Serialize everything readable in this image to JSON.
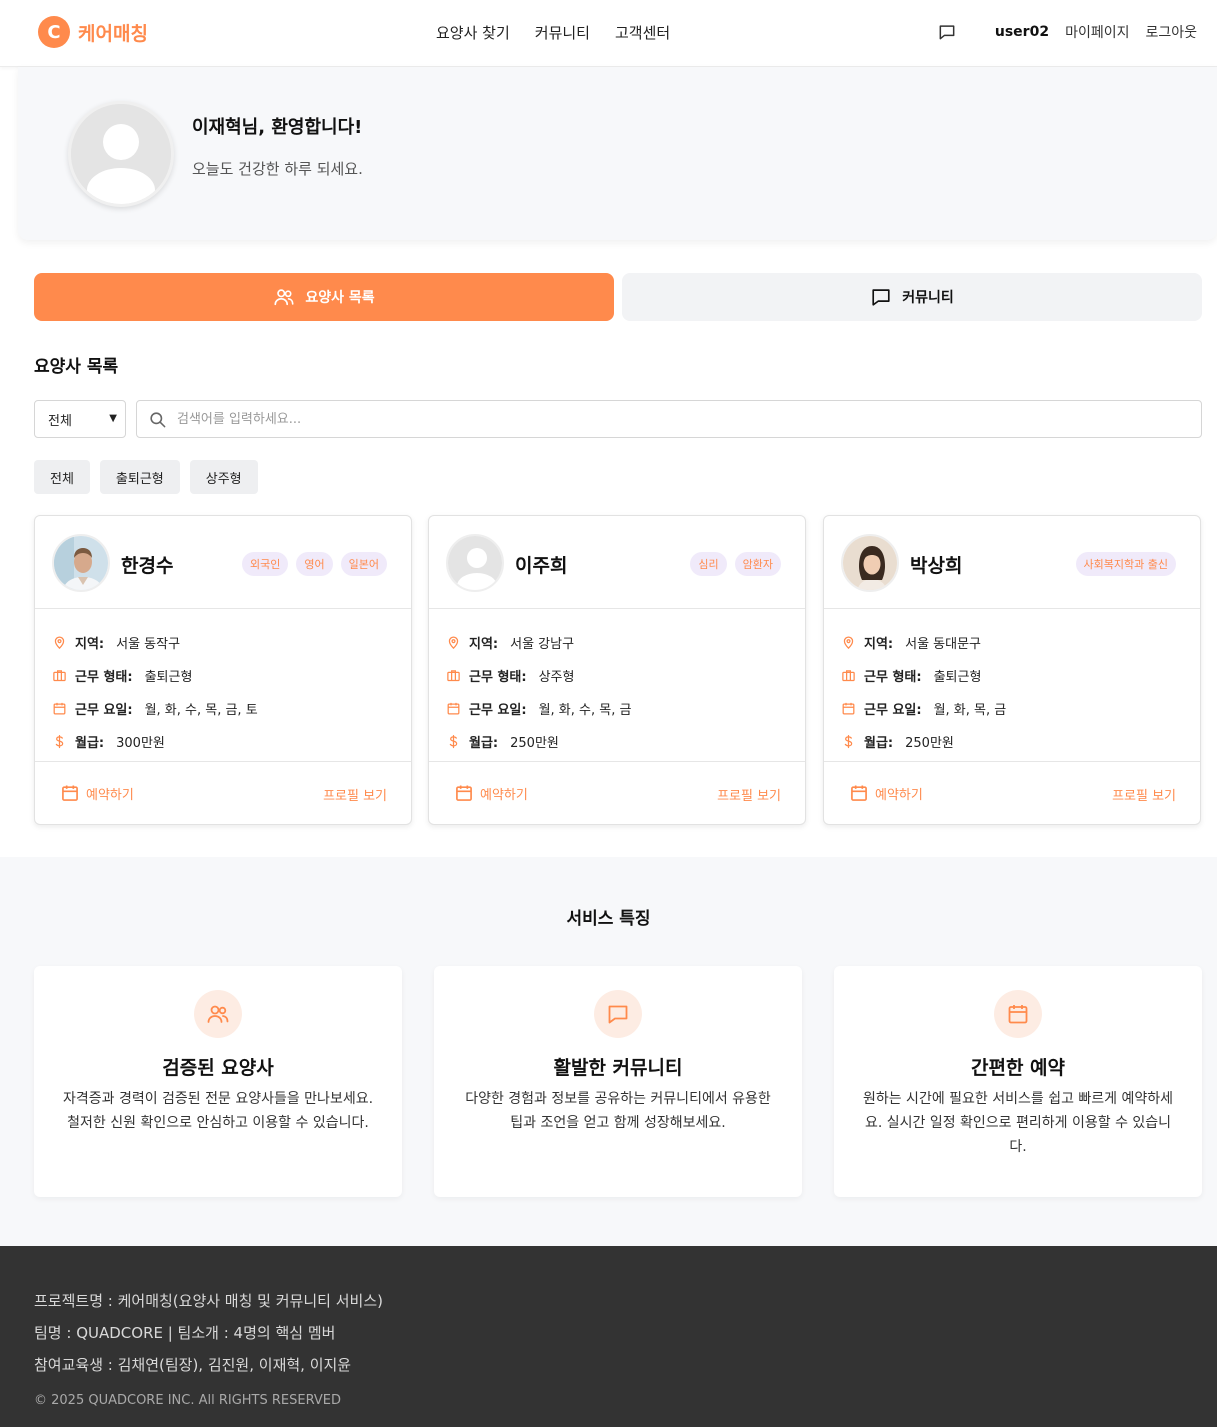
{
  "header": {
    "logo_letter": "C",
    "logo_text": "케어매칭",
    "nav": [
      "요양사 찾기",
      "커뮤니티",
      "고객센터"
    ],
    "username": "user02",
    "mypage": "마이페이지",
    "logout": "로그아웃"
  },
  "welcome": {
    "title": "이재혁님, 환영합니다!",
    "subtitle": "오늘도 건강한 하루 되세요."
  },
  "tabs": {
    "caregivers": "요양사 목록",
    "community": "커뮤니티"
  },
  "list": {
    "title": "요양사 목록",
    "select_value": "전체",
    "search_placeholder": "검색어를 입력하세요...",
    "filters": [
      "전체",
      "출퇴근형",
      "상주형"
    ]
  },
  "labels": {
    "region": "지역:",
    "work_type": "근무 형태:",
    "work_days": "근무 요일:",
    "salary": "월급:",
    "book": "예약하기",
    "profile": "프로필 보기"
  },
  "caregivers": [
    {
      "name": "한경수",
      "tags": [
        "외국인",
        "영어",
        "일본어"
      ],
      "region": "서울 동작구",
      "work_type": "출퇴근형",
      "work_days": "월, 화, 수, 목, 금, 토",
      "salary": "300만원"
    },
    {
      "name": "이주희",
      "tags": [
        "심리",
        "암환자"
      ],
      "region": "서울 강남구",
      "work_type": "상주형",
      "work_days": "월, 화, 수, 목, 금",
      "salary": "250만원"
    },
    {
      "name": "박상희",
      "tags": [
        "사회복지학과 출신"
      ],
      "region": "서울 동대문구",
      "work_type": "출퇴근형",
      "work_days": "월, 화, 목, 금",
      "salary": "250만원"
    }
  ],
  "features": {
    "title": "서비스 특징",
    "items": [
      {
        "icon": "users-icon",
        "title": "검증된 요양사",
        "desc": "자격증과 경력이 검증된 전문 요양사들을 만나보세요. 철저한 신원 확인으로 안심하고 이용할 수 있습니다."
      },
      {
        "icon": "chat-icon",
        "title": "활발한 커뮤니티",
        "desc": "다양한 경험과 정보를 공유하는 커뮤니티에서 유용한 팁과 조언을 얻고 함께 성장해보세요."
      },
      {
        "icon": "calendar-icon",
        "title": "간편한 예약",
        "desc": "원하는 시간에 필요한 서비스를 쉽고 빠르게 예약하세요. 실시간 일정 확인으로 편리하게 이용할 수 있습니다."
      }
    ]
  },
  "footer": {
    "line1": "프로젝트명 : 케어매칭(요양사 매칭 및 커뮤니티 서비스)",
    "line2": "팀명 : QUADCORE | 팀소개 : 4명의 핵심 멤버",
    "line3": "참여교육생 : 김채연(팀장), 김진원, 이재혁, 이지윤",
    "copyright": "© 2025 QUADCORE INC. All RIGHTS RESERVED"
  },
  "colors": {
    "accent": "#ff8a4c",
    "tag_bg": "#f0eafa",
    "footer_bg": "#333333"
  }
}
